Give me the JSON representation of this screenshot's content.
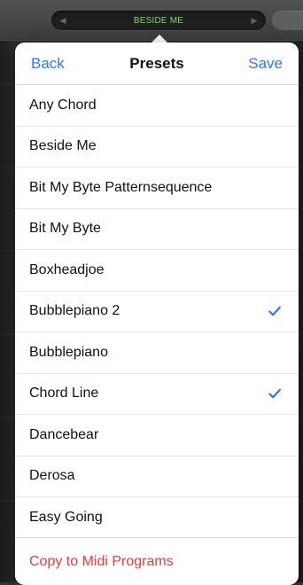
{
  "top_bar": {
    "current_preset": "BESIDE ME"
  },
  "popover": {
    "header": {
      "back_label": "Back",
      "title": "Presets",
      "save_label": "Save"
    },
    "items": [
      {
        "label": "Any Chord",
        "checked": false
      },
      {
        "label": "Beside Me",
        "checked": false
      },
      {
        "label": "Bit My Byte Patternsequence",
        "checked": false
      },
      {
        "label": "Bit My Byte",
        "checked": false
      },
      {
        "label": "Boxheadjoe",
        "checked": false
      },
      {
        "label": "Bubblepiano 2",
        "checked": true
      },
      {
        "label": "Bubblepiano",
        "checked": false
      },
      {
        "label": "Chord Line",
        "checked": true
      },
      {
        "label": "Dancebear",
        "checked": false
      },
      {
        "label": "Derosa",
        "checked": false
      },
      {
        "label": "Easy Going",
        "checked": false
      }
    ],
    "footer": {
      "action_label": "Copy to Midi Programs"
    }
  },
  "colors": {
    "accent": "#2f7ae5",
    "destructive": "#e83c3c",
    "preset_green": "#7ddc4b"
  },
  "icons": {
    "checkmark": "checkmark-icon",
    "chevron_left": "chevron-left-icon",
    "chevron_right": "chevron-right-icon"
  }
}
